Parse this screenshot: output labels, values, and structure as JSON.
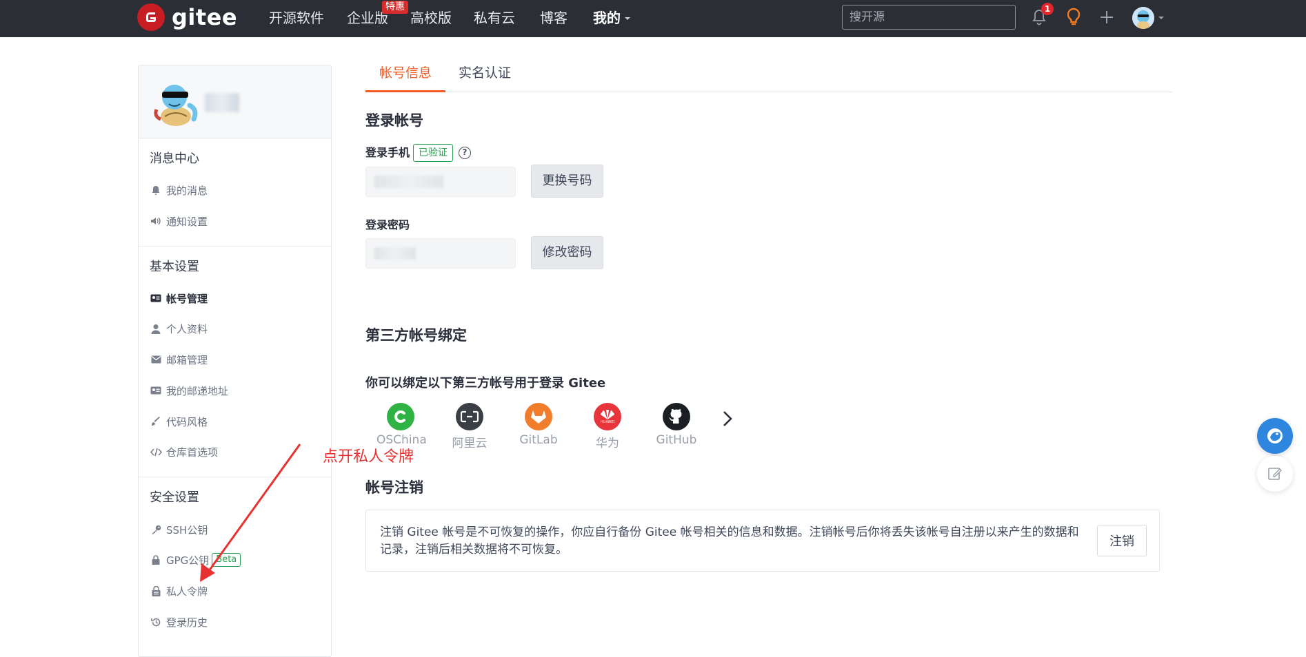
{
  "topbar": {
    "logo_text": "gitee",
    "nav": [
      "开源软件",
      "企业版",
      "高校版",
      "私有云",
      "博客",
      "我的"
    ],
    "enterprise_tag": "特惠",
    "search_placeholder": "搜开源",
    "notification_count": "1",
    "icons": [
      "bell-icon",
      "lightbulb-icon",
      "plus-icon",
      "avatar",
      "caret-down-icon"
    ]
  },
  "sidebar": {
    "sections": [
      {
        "title": "消息中心",
        "items": [
          {
            "label": "我的消息",
            "icon": "bell-icon"
          },
          {
            "label": "通知设置",
            "icon": "speaker-icon"
          }
        ]
      },
      {
        "title": "基本设置",
        "items": [
          {
            "label": "帐号管理",
            "icon": "id-card-icon"
          },
          {
            "label": "个人资料",
            "icon": "user-icon"
          },
          {
            "label": "邮箱管理",
            "icon": "envelope-icon"
          },
          {
            "label": "我的邮递地址",
            "icon": "address-card-icon"
          },
          {
            "label": "代码风格",
            "icon": "brush-icon"
          },
          {
            "label": "仓库首选项",
            "icon": "code-icon"
          }
        ]
      },
      {
        "title": "安全设置",
        "items": [
          {
            "label": "SSH公钥",
            "icon": "key-icon"
          },
          {
            "label": "GPG公钥",
            "icon": "lock-icon"
          },
          {
            "label": "私人令牌",
            "icon": "token-icon"
          },
          {
            "label": "登录历史",
            "icon": "history-icon"
          }
        ]
      }
    ],
    "active_item": "帐号管理",
    "beta_label": "Beta"
  },
  "main": {
    "tabs": [
      "帐号信息",
      "实名认证"
    ],
    "login_account_title": "登录帐号",
    "phone_label": "登录手机",
    "verified_label": "已验证",
    "help_glyph": "?",
    "change_phone_btn": "更换号码",
    "password_label": "登录密码",
    "change_password_btn": "修改密码",
    "third_party_title": "第三方帐号绑定",
    "third_party_tip": "你可以绑定以下第三方帐号用于登录 Gitee",
    "providers": [
      {
        "name": "OSChina",
        "color": "#2fb344"
      },
      {
        "name": "阿里云",
        "color": "#3a3f46"
      },
      {
        "name": "GitLab",
        "color": "#f07d2c"
      },
      {
        "name": "华为",
        "color": "#e8343b"
      },
      {
        "name": "GitHub",
        "color": "#1b1f23"
      }
    ],
    "huawei_small": "HUAWEI",
    "cancel_title": "帐号注销",
    "cancel_text": "注销 Gitee 帐号是不可恢复的操作，你应自行备份 Gitee 帐号相关的信息和数据。注销帐号后你将丢失该帐号自注册以来产生的数据和记录，注销后相关数据将不可恢复。",
    "cancel_btn": "注销"
  },
  "annotation": {
    "text": "点开私人令牌",
    "color": "#e8322f"
  },
  "colors": {
    "accent": "#f15a24",
    "topbar": "#2b2e35",
    "verified": "#2aa050",
    "float_blue": "#2e86de"
  }
}
